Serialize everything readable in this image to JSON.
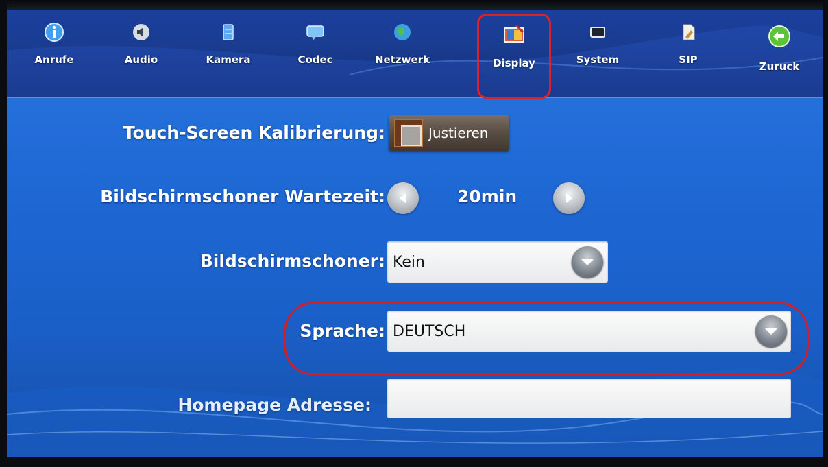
{
  "nav": {
    "items": [
      {
        "label": "Anrufe",
        "icon": "info-icon"
      },
      {
        "label": "Audio",
        "icon": "speaker-icon"
      },
      {
        "label": "Kamera",
        "icon": "camera-icon"
      },
      {
        "label": "Codec",
        "icon": "chat-icon"
      },
      {
        "label": "Netzwerk",
        "icon": "globe-icon"
      },
      {
        "label": "Display",
        "icon": "display-icon",
        "active": true
      },
      {
        "label": "System",
        "icon": "system-icon"
      },
      {
        "label": "SIP",
        "icon": "document-icon"
      },
      {
        "label": "Zuruck",
        "icon": "back-arrow-icon"
      }
    ]
  },
  "settings": {
    "touch_label": "Touch-Screen Kalibrierung:",
    "touch_button": "Justieren",
    "timeout_label": "Bildschirmschoner Wartezeit:",
    "timeout_value": "20min",
    "screensaver_label": "Bildschirmschoner:",
    "screensaver_value": "Kein",
    "language_label": "Sprache:",
    "language_value": "DEUTSCH",
    "homepage_label": "Homepage Adresse:",
    "homepage_value": ""
  },
  "colors": {
    "screen_blue": "#1f6ad6",
    "highlight_red": "#d11f29"
  }
}
